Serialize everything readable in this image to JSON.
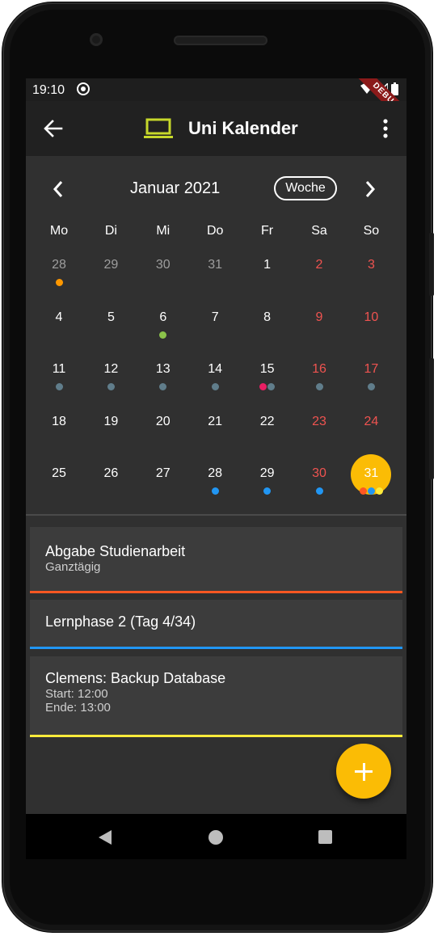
{
  "status": {
    "time": "19:10",
    "debug_banner": "DEBUG"
  },
  "app": {
    "title": "Uni Kalender",
    "accent": "#c6d82b"
  },
  "calendar": {
    "month_label": "Januar 2021",
    "format_button": "Woche",
    "weekdays": [
      "Mo",
      "Di",
      "Mi",
      "Do",
      "Fr",
      "Sa",
      "So"
    ],
    "weeks": [
      [
        "28",
        "29",
        "30",
        "31",
        "1",
        "2",
        "3"
      ],
      [
        "4",
        "5",
        "6",
        "7",
        "8",
        "9",
        "10"
      ],
      [
        "11",
        "12",
        "13",
        "14",
        "15",
        "16",
        "17"
      ],
      [
        "18",
        "19",
        "20",
        "21",
        "22",
        "23",
        "24"
      ],
      [
        "25",
        "26",
        "27",
        "28",
        "29",
        "30",
        "31"
      ]
    ],
    "colors": {
      "weekday_text": "#ffffff",
      "weekend_text": "#ef5350",
      "outside_text": "#9e9e9e",
      "today_fill": "#fbbc05"
    },
    "markers": [
      {
        "week": 0,
        "day": 0,
        "colors": [
          "#ff9800"
        ]
      },
      {
        "week": 1,
        "day": 2,
        "colors": [
          "#8bc34a"
        ]
      },
      {
        "week": 2,
        "day": 0,
        "colors": [
          "#607d8b"
        ]
      },
      {
        "week": 2,
        "day": 1,
        "colors": [
          "#607d8b"
        ]
      },
      {
        "week": 2,
        "day": 2,
        "colors": [
          "#607d8b"
        ]
      },
      {
        "week": 2,
        "day": 3,
        "colors": [
          "#607d8b"
        ]
      },
      {
        "week": 2,
        "day": 4,
        "colors": [
          "#e91e63",
          "#607d8b"
        ]
      },
      {
        "week": 2,
        "day": 5,
        "colors": [
          "#607d8b"
        ]
      },
      {
        "week": 2,
        "day": 6,
        "colors": [
          "#607d8b"
        ]
      },
      {
        "week": 4,
        "day": 3,
        "colors": [
          "#2196f3"
        ]
      },
      {
        "week": 4,
        "day": 4,
        "colors": [
          "#2196f3"
        ]
      },
      {
        "week": 4,
        "day": 5,
        "colors": [
          "#2196f3"
        ]
      },
      {
        "week": 4,
        "day": 6,
        "colors": [
          "#ff5722",
          "#2196f3",
          "#ffeb3b"
        ]
      }
    ],
    "today": {
      "week": 4,
      "day": 6
    }
  },
  "events": [
    {
      "title": "Abgabe Studienarbeit",
      "lines": [
        "Ganztägig"
      ],
      "color": "#ff5722"
    },
    {
      "title": "Lernphase 2 (Tag 4/34)",
      "lines": [],
      "color": "#2196f3"
    },
    {
      "title": "Clemens: Backup Database",
      "lines": [
        "Start: 12:00",
        "Ende: 13:00"
      ],
      "color": "#ffeb3b"
    }
  ],
  "fab": {
    "icon": "add-icon"
  }
}
